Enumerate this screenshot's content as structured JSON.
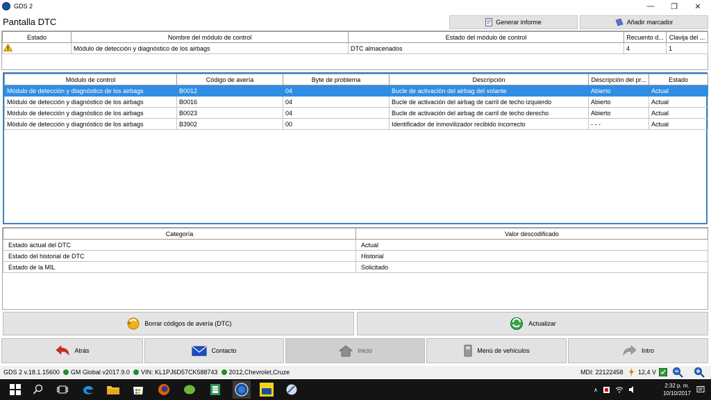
{
  "app": {
    "title": "GDS 2"
  },
  "window_controls": {
    "minimize": "—",
    "maximize": "❐",
    "close": "✕"
  },
  "header": {
    "title": "Pantalla DTC",
    "report_label": "Generar informe",
    "bookmark_label": "Añadir marcador"
  },
  "module_table": {
    "headers": [
      "Estado",
      "Nombre del módulo de control",
      "Estado del módulo de control",
      "Recuento d...",
      "Clavija del ..."
    ],
    "row": {
      "name": "Módulo de detección y diagnóstico de los airbags",
      "state": "DTC almacenados",
      "count": "4",
      "pin": "1"
    }
  },
  "dtc_table": {
    "headers": [
      "Módulo de control",
      "Código de avería",
      "Byte de problema",
      "Descripción",
      "Descripción del pr...",
      "Estado"
    ],
    "rows": [
      {
        "module": "Módulo de detección y diagnóstico de los airbags",
        "code": "B0012",
        "byte": "04",
        "desc": "Bucle de activación del airbag del volante",
        "desc2": "Abierto",
        "status": "Actual"
      },
      {
        "module": "Módulo de detección y diagnóstico de los airbags",
        "code": "B0016",
        "byte": "04",
        "desc": "Bucle de activación del airbag de carril de techo izquierdo",
        "desc2": "Abierto",
        "status": "Actual"
      },
      {
        "module": "Módulo de detección y diagnóstico de los airbags",
        "code": "B0023",
        "byte": "04",
        "desc": "Bucle de activación del airbag de carril de techo derecho",
        "desc2": "Abierto",
        "status": "Actual"
      },
      {
        "module": "Módulo de detección y diagnóstico de los airbags",
        "code": "B3902",
        "byte": "00",
        "desc": "Identificador de inmovilizador recibido incorrecto",
        "desc2": "- - -",
        "status": "Actual"
      }
    ]
  },
  "decode_table": {
    "headers": [
      "Categoría",
      "Valor descodificado"
    ],
    "rows": [
      {
        "category": "Estado actual del DTC",
        "value": "Actual"
      },
      {
        "category": "Estado del historial de DTC",
        "value": "Historial"
      },
      {
        "category": "Estado de la MIL",
        "value": "Solicitado"
      }
    ]
  },
  "actions": {
    "clear": "Borrar códigos de avería (DTC)",
    "refresh": "Actualizar"
  },
  "nav": {
    "back": "Atrás",
    "contact": "Contacto",
    "home": "Inicio",
    "vehicles": "Menú de vehículos",
    "intro": "Intro"
  },
  "status": {
    "version": "GDS 2 v.18.1.15600",
    "gm_global": "GM Global v2017.9.0",
    "vin": "VIN: KL1PJ6D57CK588743",
    "vehicle": "2012,Chevrolet,Cruze",
    "mdi": "MDI: 22122458",
    "voltage": "12,4 V"
  },
  "taskbar": {
    "time": "2:32 p. m.",
    "date": "10/10/2017"
  }
}
